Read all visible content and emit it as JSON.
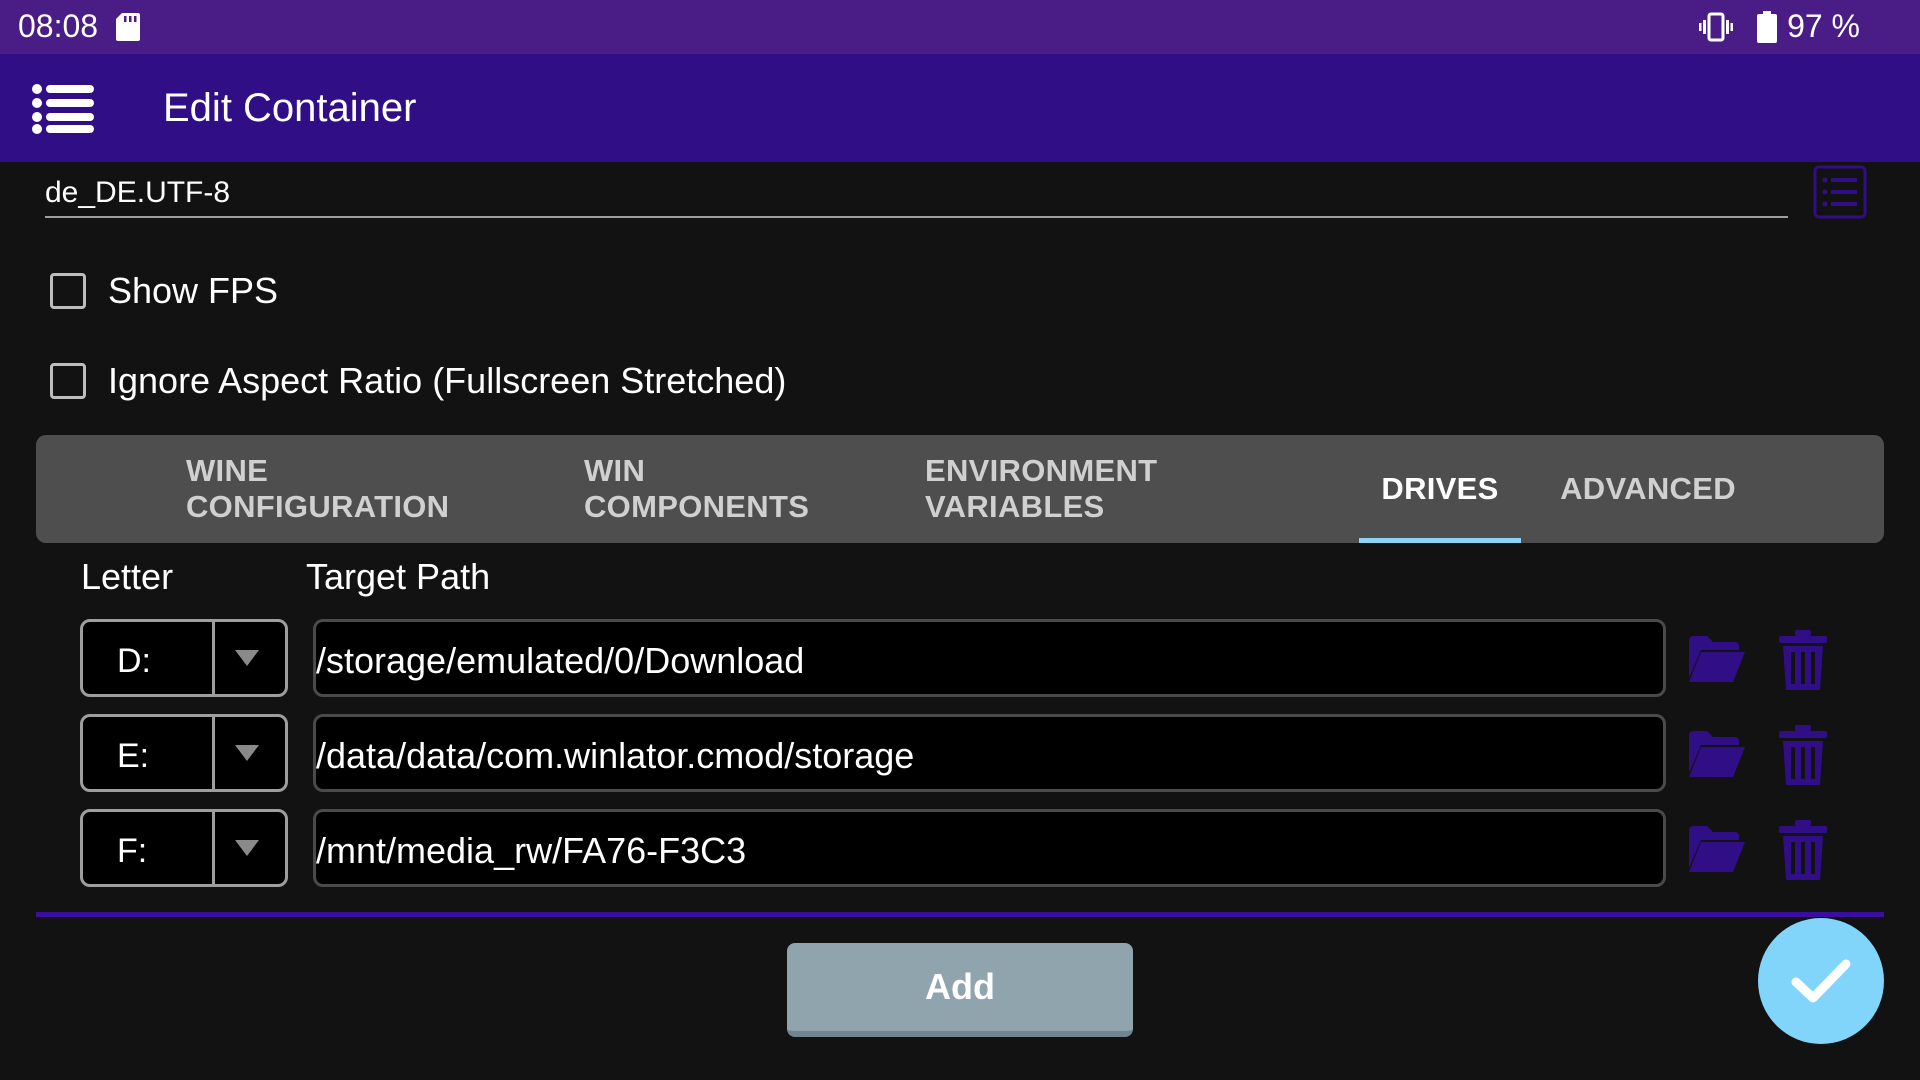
{
  "status_bar": {
    "time": "08:08",
    "sd_icon": "sd-card-icon",
    "vibrate_icon": "vibrate-icon",
    "battery_icon": "battery-icon",
    "battery_percent": "97 %"
  },
  "app_bar": {
    "title": "Edit Container",
    "menu_icon": "menu-icon"
  },
  "locale": {
    "value": "de_DE.UTF-8",
    "list_icon": "list-icon"
  },
  "checkboxes": [
    {
      "label": "Show FPS",
      "checked": false
    },
    {
      "label": "Ignore Aspect Ratio (Fullscreen Stretched)",
      "checked": false
    }
  ],
  "tabs": [
    {
      "label": "WINE CONFIGURATION",
      "active": false
    },
    {
      "label": "WIN COMPONENTS",
      "active": false
    },
    {
      "label": "ENVIRONMENT VARIABLES",
      "active": false
    },
    {
      "label": "DRIVES",
      "active": true
    },
    {
      "label": "ADVANCED",
      "active": false
    }
  ],
  "drives": {
    "columns": {
      "letter": "Letter",
      "path": "Target Path"
    },
    "rows": [
      {
        "letter": "D:",
        "path": "/storage/emulated/0/Download"
      },
      {
        "letter": "E:",
        "path": "/data/data/com.winlator.cmod/storage"
      },
      {
        "letter": "F:",
        "path": "/mnt/media_rw/FA76-F3C3"
      }
    ],
    "folder_icon": "folder-icon",
    "delete_icon": "trash-icon"
  },
  "add_button": {
    "label": "Add"
  },
  "confirm_fab": {
    "icon": "check-icon"
  },
  "colors": {
    "status_bar": "#4a1c86",
    "app_bar": "#300e86",
    "accent_icon": "#300e86",
    "tab_indicator": "#8fd3f4",
    "fab": "#81d4fa",
    "add_button": "#90a4ae",
    "background": "#121212"
  }
}
